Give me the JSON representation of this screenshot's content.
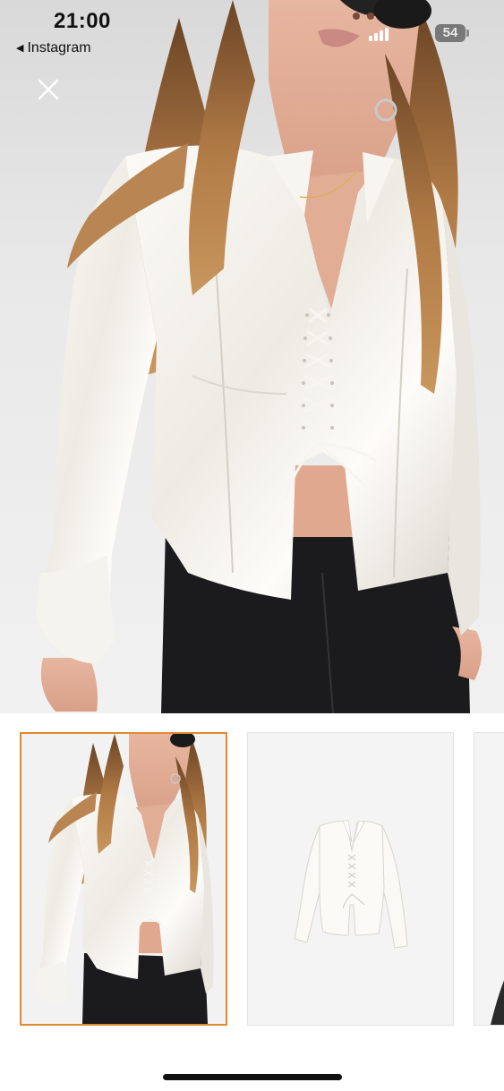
{
  "status_bar": {
    "time": "21:00",
    "back_app_label": "Instagram",
    "battery_level": "54"
  },
  "icons": {
    "close": "close-icon",
    "back": "back-triangle-icon",
    "signal": "signal-bars-icon",
    "battery": "battery-icon"
  },
  "gallery": {
    "selected_index": 0,
    "thumbnail_count": 3,
    "selected_border_color": "#e08a2f"
  },
  "colors": {
    "background": "#ffffff",
    "thumb_background": "#f4f4f4",
    "blouse": "#f3f1ec",
    "hair": "#a8703f",
    "pants": "#1b1b1d"
  }
}
